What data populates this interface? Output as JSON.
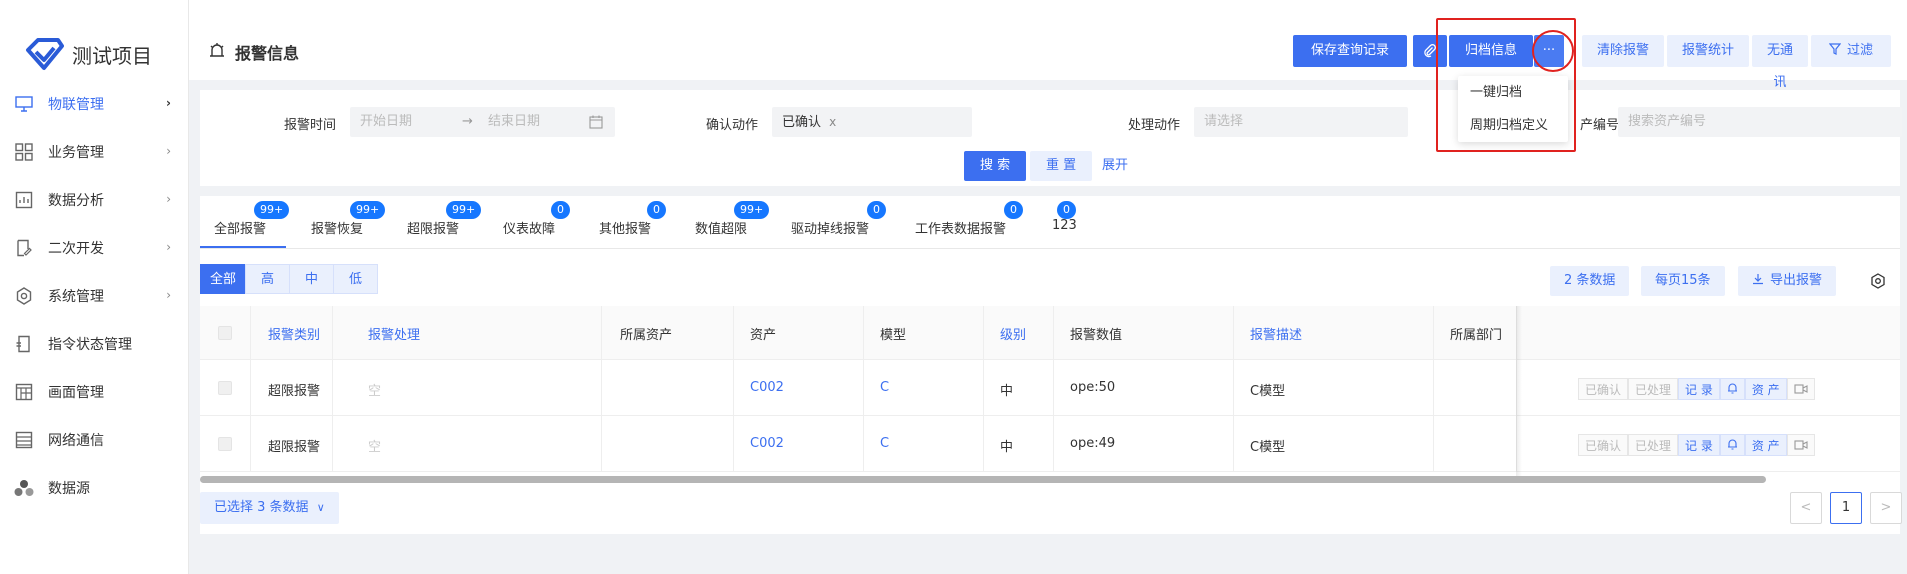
{
  "app": {
    "title": "测试项目"
  },
  "sidebar": {
    "items": [
      {
        "label": "物联管理",
        "icon": "monitor-icon",
        "active": true,
        "has_chevron": true
      },
      {
        "label": "业务管理",
        "icon": "grid-icon",
        "has_chevron": true
      },
      {
        "label": "数据分析",
        "icon": "chart-doc-icon",
        "has_chevron": true
      },
      {
        "label": "二次开发",
        "icon": "edit-doc-icon",
        "has_chevron": true
      },
      {
        "label": "系统管理",
        "icon": "gear-icon",
        "has_chevron": true
      },
      {
        "label": "指令状态管理",
        "icon": "command-icon",
        "has_chevron": false
      },
      {
        "label": "画面管理",
        "icon": "layout-icon",
        "has_chevron": false
      },
      {
        "label": "网络通信",
        "icon": "list-icon",
        "has_chevron": false
      },
      {
        "label": "数据源",
        "icon": "cluster-icon",
        "has_chevron": false
      }
    ],
    "chevron": "›"
  },
  "header": {
    "title": "报警信息",
    "buttons": {
      "save_query": "保存查询记录",
      "archive_info": "归档信息",
      "more": "···",
      "clear_alarm": "清除报警",
      "alarm_stats": "报警统计",
      "no_comm": "无通讯",
      "filter": "过滤"
    },
    "dropdown": [
      "一键归档",
      "周期归档定义"
    ]
  },
  "filter": {
    "alarm_time_label": "报警时间",
    "start_placeholder": "开始日期",
    "arrow": "→",
    "end_placeholder": "结束日期",
    "confirm_label": "确认动作",
    "confirm_value": "已确认",
    "confirm_clear": "x",
    "handle_label": "处理动作",
    "handle_placeholder": "请选择",
    "asset_label": "产编号",
    "asset_placeholder": "搜索资产编号",
    "search": "搜 索",
    "reset": "重 置",
    "expand": "展开"
  },
  "tabs": [
    {
      "label": "全部报警",
      "badge": "99+"
    },
    {
      "label": "报警恢复",
      "badge": "99+"
    },
    {
      "label": "超限报警",
      "badge": "99+"
    },
    {
      "label": "仪表故障",
      "badge": "0"
    },
    {
      "label": "其他报警",
      "badge": "0"
    },
    {
      "label": "数值超限",
      "badge": "99+"
    },
    {
      "label": "驱动掉线报警",
      "badge": "0"
    },
    {
      "label": "工作表数据报警",
      "badge": "0"
    },
    {
      "label": "123",
      "badge": "0"
    }
  ],
  "levels": [
    "全部",
    "高",
    "中",
    "低"
  ],
  "toolbar": {
    "count": "2 条数据",
    "per_page": "每页15条",
    "export": "导出报警"
  },
  "table": {
    "columns": [
      "报警类别",
      "报警处理",
      "所属资产",
      "资产",
      "模型",
      "级别",
      "报警数值",
      "报警描述",
      "所属部门"
    ],
    "rows": [
      {
        "category": "超限报警",
        "handle": "空",
        "owner_asset": "",
        "asset": "C002",
        "model": "C",
        "level": "中",
        "value": "ope:50",
        "desc": "C模型",
        "dept": ""
      },
      {
        "category": "超限报警",
        "handle": "空",
        "owner_asset": "",
        "asset": "C002",
        "model": "C",
        "level": "中",
        "value": "ope:49",
        "desc": "C模型",
        "dept": ""
      }
    ],
    "ops": {
      "confirmed": "已确认",
      "handled": "已处理",
      "record": "记 录",
      "asset": "资 产"
    }
  },
  "footer": {
    "selected": "已选择 3 条数据",
    "selected_caret": "∨",
    "prev": "<",
    "page": "1",
    "next": ">"
  },
  "colors": {
    "primary": "#3c6ff0",
    "light": "#eaf0fd",
    "badge": "#1677ff",
    "highlight": "#e0221f"
  }
}
